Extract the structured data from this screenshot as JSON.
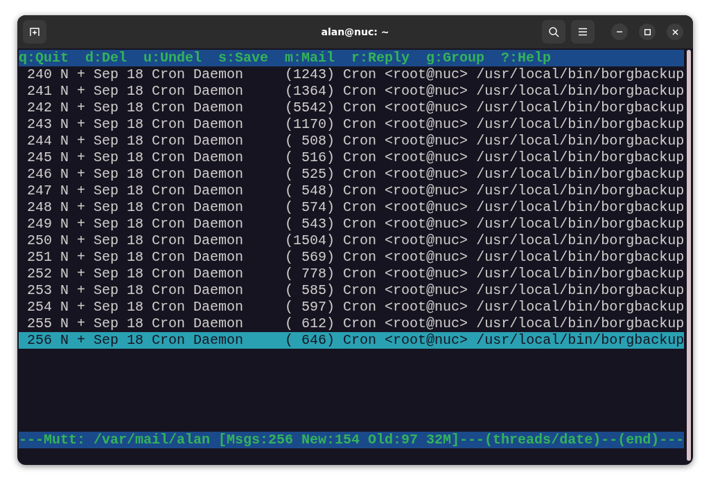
{
  "window": {
    "title": "alan@nuc: ~"
  },
  "help_bar": [
    "q:Quit",
    "d:Del",
    "u:Undel",
    "s:Save",
    "m:Mail",
    "r:Reply",
    "g:Group",
    "?:Help"
  ],
  "messages": [
    {
      "number": "240",
      "status": "N",
      "tag": "+",
      "date": "Sep 18",
      "from": "Cron Daemon",
      "size": "(1243)",
      "subject": "Cron <root@nuc> /usr/local/bin/borgbackup",
      "selected": false
    },
    {
      "number": "241",
      "status": "N",
      "tag": "+",
      "date": "Sep 18",
      "from": "Cron Daemon",
      "size": "(1364)",
      "subject": "Cron <root@nuc> /usr/local/bin/borgbackup",
      "selected": false
    },
    {
      "number": "242",
      "status": "N",
      "tag": "+",
      "date": "Sep 18",
      "from": "Cron Daemon",
      "size": "(5542)",
      "subject": "Cron <root@nuc> /usr/local/bin/borgbackup",
      "selected": false
    },
    {
      "number": "243",
      "status": "N",
      "tag": "+",
      "date": "Sep 18",
      "from": "Cron Daemon",
      "size": "(1170)",
      "subject": "Cron <root@nuc> /usr/local/bin/borgbackup",
      "selected": false
    },
    {
      "number": "244",
      "status": "N",
      "tag": "+",
      "date": "Sep 18",
      "from": "Cron Daemon",
      "size": "( 508)",
      "subject": "Cron <root@nuc> /usr/local/bin/borgbackup",
      "selected": false
    },
    {
      "number": "245",
      "status": "N",
      "tag": "+",
      "date": "Sep 18",
      "from": "Cron Daemon",
      "size": "( 516)",
      "subject": "Cron <root@nuc> /usr/local/bin/borgbackup",
      "selected": false
    },
    {
      "number": "246",
      "status": "N",
      "tag": "+",
      "date": "Sep 18",
      "from": "Cron Daemon",
      "size": "( 525)",
      "subject": "Cron <root@nuc> /usr/local/bin/borgbackup",
      "selected": false
    },
    {
      "number": "247",
      "status": "N",
      "tag": "+",
      "date": "Sep 18",
      "from": "Cron Daemon",
      "size": "( 548)",
      "subject": "Cron <root@nuc> /usr/local/bin/borgbackup",
      "selected": false
    },
    {
      "number": "248",
      "status": "N",
      "tag": "+",
      "date": "Sep 18",
      "from": "Cron Daemon",
      "size": "( 574)",
      "subject": "Cron <root@nuc> /usr/local/bin/borgbackup",
      "selected": false
    },
    {
      "number": "249",
      "status": "N",
      "tag": "+",
      "date": "Sep 18",
      "from": "Cron Daemon",
      "size": "( 543)",
      "subject": "Cron <root@nuc> /usr/local/bin/borgbackup",
      "selected": false
    },
    {
      "number": "250",
      "status": "N",
      "tag": "+",
      "date": "Sep 18",
      "from": "Cron Daemon",
      "size": "(1504)",
      "subject": "Cron <root@nuc> /usr/local/bin/borgbackup",
      "selected": false
    },
    {
      "number": "251",
      "status": "N",
      "tag": "+",
      "date": "Sep 18",
      "from": "Cron Daemon",
      "size": "( 569)",
      "subject": "Cron <root@nuc> /usr/local/bin/borgbackup",
      "selected": false
    },
    {
      "number": "252",
      "status": "N",
      "tag": "+",
      "date": "Sep 18",
      "from": "Cron Daemon",
      "size": "( 778)",
      "subject": "Cron <root@nuc> /usr/local/bin/borgbackup",
      "selected": false
    },
    {
      "number": "253",
      "status": "N",
      "tag": "+",
      "date": "Sep 18",
      "from": "Cron Daemon",
      "size": "( 585)",
      "subject": "Cron <root@nuc> /usr/local/bin/borgbackup",
      "selected": false
    },
    {
      "number": "254",
      "status": "N",
      "tag": "+",
      "date": "Sep 18",
      "from": "Cron Daemon",
      "size": "( 597)",
      "subject": "Cron <root@nuc> /usr/local/bin/borgbackup",
      "selected": false
    },
    {
      "number": "255",
      "status": "N",
      "tag": "+",
      "date": "Sep 18",
      "from": "Cron Daemon",
      "size": "( 612)",
      "subject": "Cron <root@nuc> /usr/local/bin/borgbackup",
      "selected": false
    },
    {
      "number": "256",
      "status": "N",
      "tag": "+",
      "date": "Sep 18",
      "from": "Cron Daemon",
      "size": "( 646)",
      "subject": "Cron <root@nuc> /usr/local/bin/borgbackup",
      "selected": true
    }
  ],
  "status_bar": "---Mutt: /var/mail/alan [Msgs:256 New:154 Old:97 32M]---(threads/date)--(end)---"
}
